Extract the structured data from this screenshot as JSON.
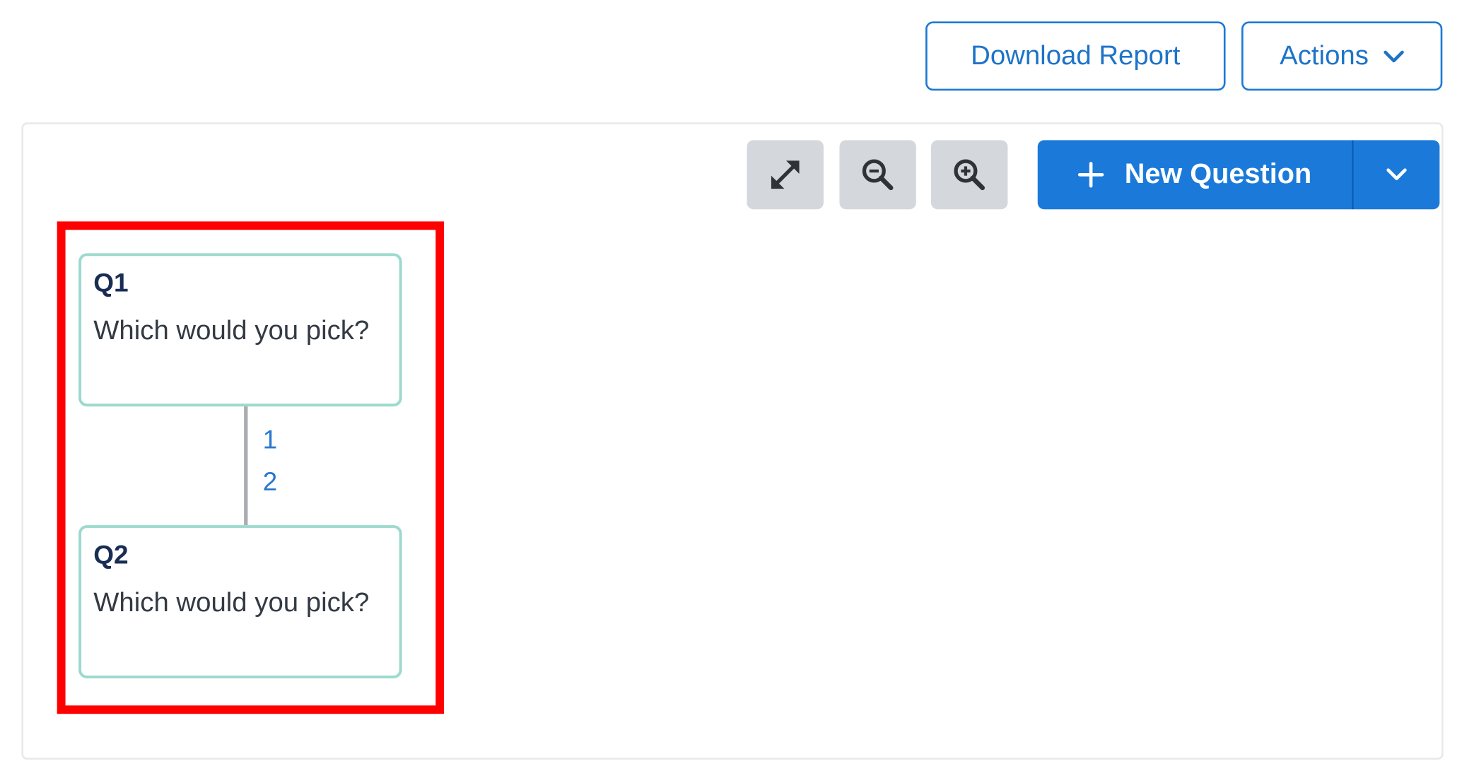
{
  "header": {
    "download_report": "Download Report",
    "actions": "Actions"
  },
  "toolbar": {
    "expand_icon": "expand-arrows-icon",
    "zoom_out_icon": "zoom-out-icon",
    "zoom_in_icon": "zoom-in-icon",
    "new_question": "New Question"
  },
  "flow": {
    "questions": [
      {
        "id": "Q1",
        "text": "Which would you pick?"
      },
      {
        "id": "Q2",
        "text": "Which would you pick?"
      }
    ],
    "branch_labels": [
      "1",
      "2"
    ]
  },
  "colors": {
    "primary": "#1b7ad9",
    "card_border": "#9dd9ce",
    "highlight": "#ff0000",
    "tool_bg": "#d4d8dd"
  }
}
